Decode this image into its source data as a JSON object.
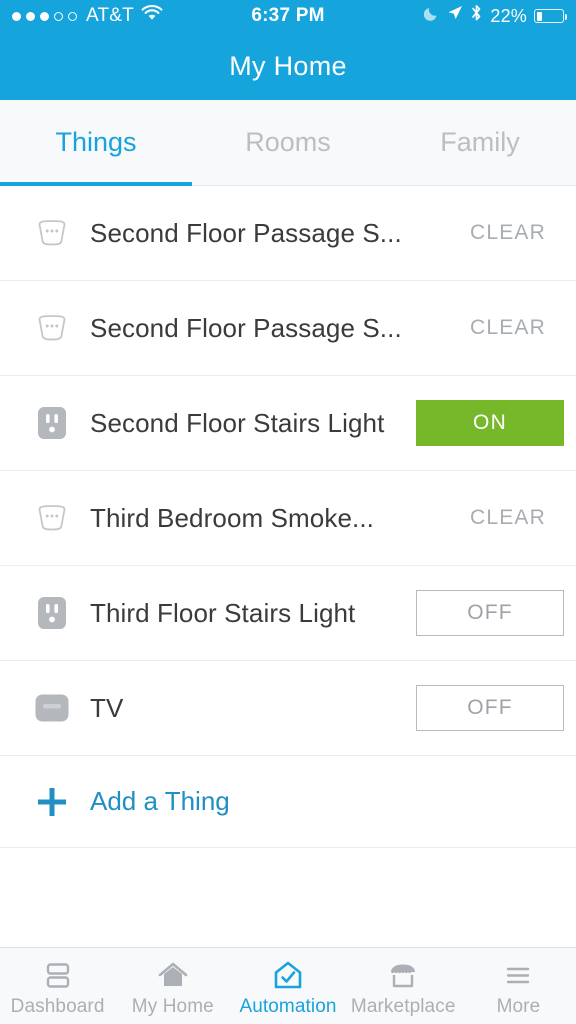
{
  "status_bar": {
    "signal_total": 5,
    "signal_filled": 3,
    "carrier": "AT&T",
    "wifi_icon": "wifi-icon",
    "time": "6:37 PM",
    "dnd_icon": "moon-icon",
    "location_icon": "location-arrow-icon",
    "bluetooth_icon": "bluetooth-icon",
    "battery_percent_label": "22%",
    "battery_level": 22
  },
  "header": {
    "title": "My Home"
  },
  "tabs": [
    {
      "label": "Things",
      "active": true
    },
    {
      "label": "Rooms",
      "active": false
    },
    {
      "label": "Family",
      "active": false
    }
  ],
  "things": [
    {
      "icon": "smoke-detector-icon",
      "name": "Second Floor Passage S...",
      "control_type": "text",
      "state": "CLEAR"
    },
    {
      "icon": "smoke-detector-icon",
      "name": "Second Floor Passage S...",
      "control_type": "text",
      "state": "CLEAR"
    },
    {
      "icon": "outlet-icon",
      "name": "Second Floor Stairs Light",
      "control_type": "button-on",
      "state": "ON"
    },
    {
      "icon": "smoke-detector-icon",
      "name": "Third  Bedroom Smoke...",
      "control_type": "text",
      "state": "CLEAR"
    },
    {
      "icon": "outlet-icon",
      "name": "Third Floor Stairs Light",
      "control_type": "button-off",
      "state": "OFF"
    },
    {
      "icon": "tv-icon",
      "name": "TV",
      "control_type": "button-off",
      "state": "OFF"
    }
  ],
  "add_thing": {
    "icon": "plus-icon",
    "label": "Add a Thing"
  },
  "bottom_nav": [
    {
      "icon": "dashboard-icon",
      "label": "Dashboard",
      "active": false
    },
    {
      "icon": "home-icon",
      "label": "My Home",
      "active": false
    },
    {
      "icon": "automation-icon",
      "label": "Automation",
      "active": true
    },
    {
      "icon": "marketplace-icon",
      "label": "Marketplace",
      "active": false
    },
    {
      "icon": "more-icon",
      "label": "More",
      "active": false
    }
  ],
  "colors": {
    "brand_blue": "#16a4dc",
    "on_green": "#76b82a",
    "muted_gray": "#a8adb2",
    "icon_gray": "#b4b8bc"
  }
}
